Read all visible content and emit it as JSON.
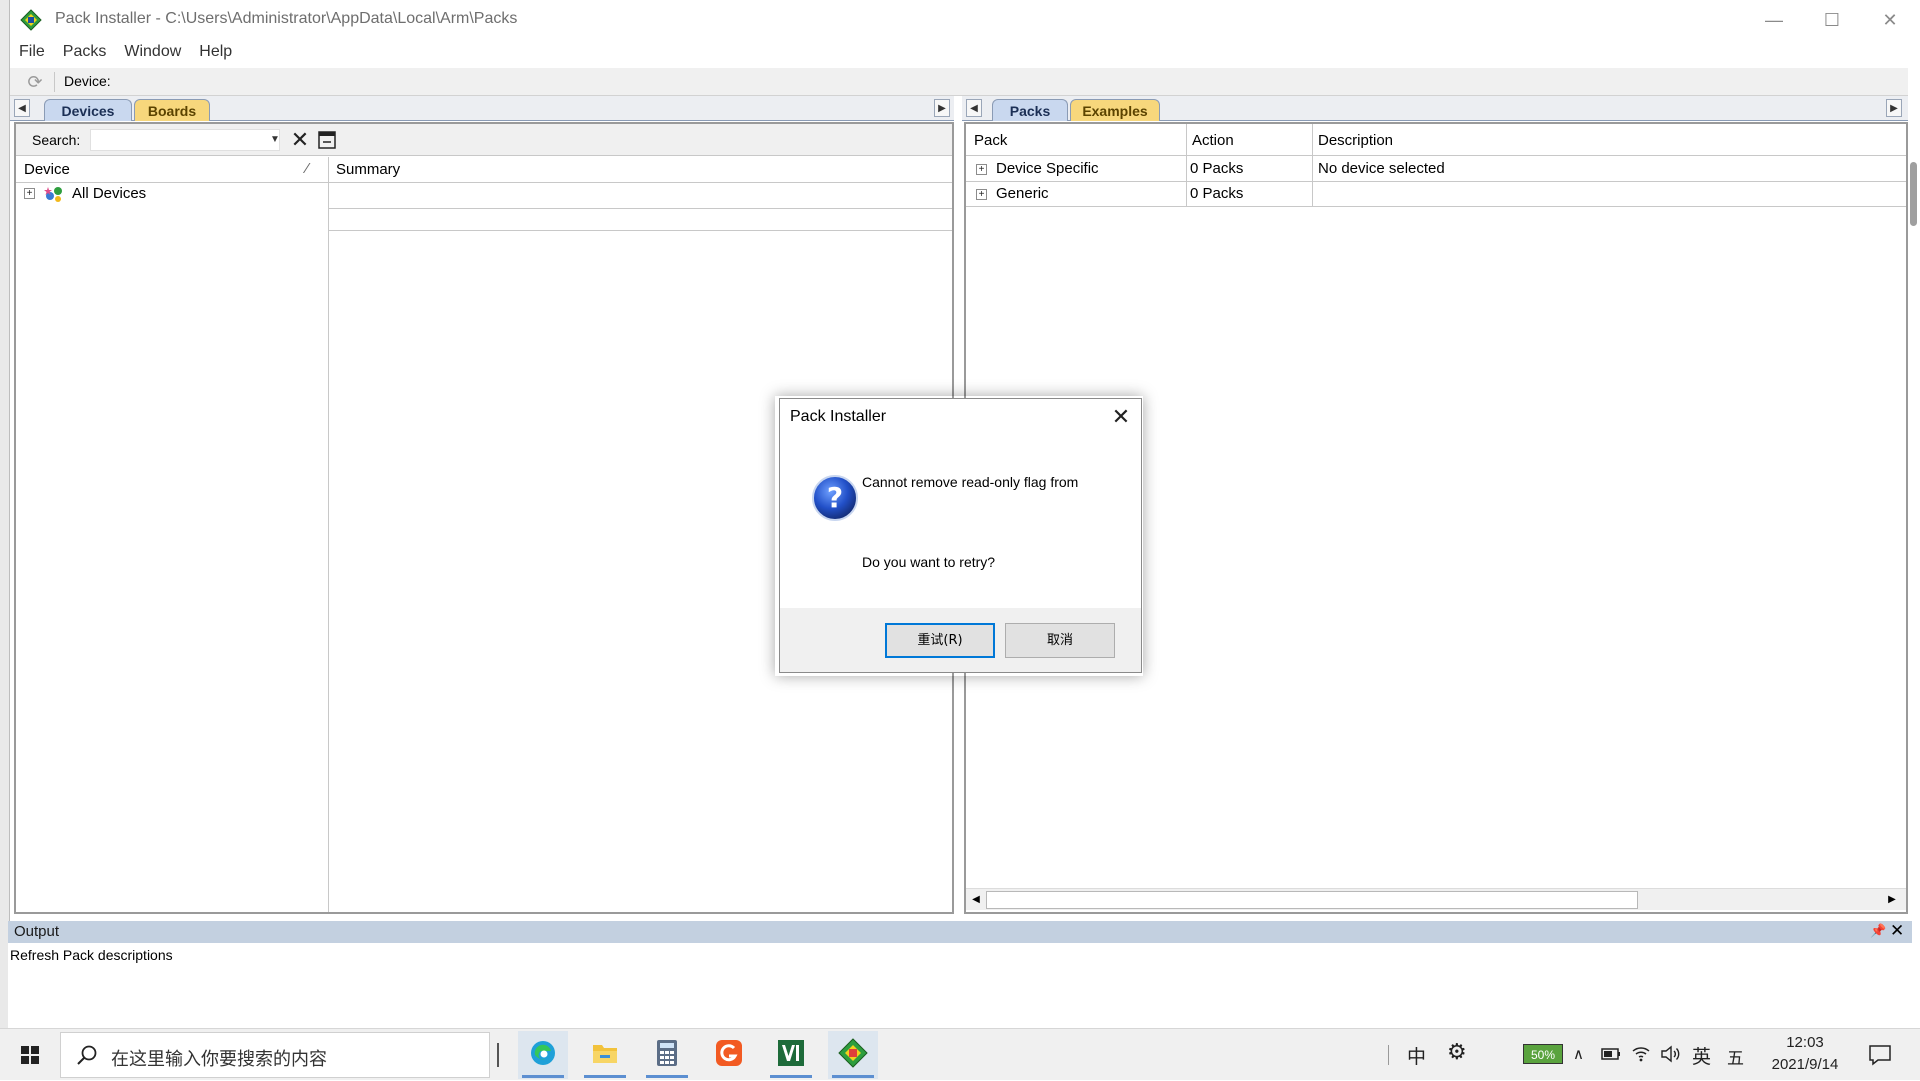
{
  "window": {
    "title": "Pack Installer - C:\\Users\\Administrator\\AppData\\Local\\Arm\\Packs",
    "min_glyph": "—",
    "max_glyph": "☐",
    "close_glyph": "✕"
  },
  "menu": {
    "items": [
      {
        "label": "File"
      },
      {
        "label": "Packs"
      },
      {
        "label": "Window"
      },
      {
        "label": "Help"
      }
    ]
  },
  "toolbar": {
    "device_label": "Device:"
  },
  "left_tabs": [
    {
      "label": "Devices",
      "active": true
    },
    {
      "label": "Boards",
      "active": false
    }
  ],
  "right_tabs": [
    {
      "label": "Packs",
      "active": true
    },
    {
      "label": "Examples",
      "active": false
    }
  ],
  "devices_panel": {
    "search_label": "Search:",
    "search_value": "",
    "columns": {
      "device": "Device",
      "summary": "Summary"
    },
    "rows": [
      {
        "label": "All Devices"
      }
    ]
  },
  "packs_panel": {
    "columns": {
      "pack": "Pack",
      "action": "Action",
      "description": "Description"
    },
    "rows": [
      {
        "pack": "Device Specific",
        "action": "0 Packs",
        "description": "No device selected"
      },
      {
        "pack": "Generic",
        "action": "0 Packs",
        "description": ""
      }
    ]
  },
  "output": {
    "title": "Output",
    "lines": [
      "Refresh Pack descriptions"
    ]
  },
  "dialog": {
    "title": "Pack Installer",
    "message_line1": "Cannot remove read-only flag from",
    "message_line2": "Do you want to retry?",
    "retry_label": "重试(R)",
    "cancel_label": "取消"
  },
  "taskbar": {
    "search_placeholder": "在这里输入你要搜索的内容",
    "ime_mode": "中",
    "battery": "50%",
    "lang": "英",
    "ime_layout": "五",
    "time": "12:03",
    "date": "2021/9/14"
  },
  "colors": {
    "active_tab": "#c9d8ef",
    "inactive_tab": "#f7d77c",
    "output_header": "#c3d0e0",
    "accent": "#0078d7"
  }
}
